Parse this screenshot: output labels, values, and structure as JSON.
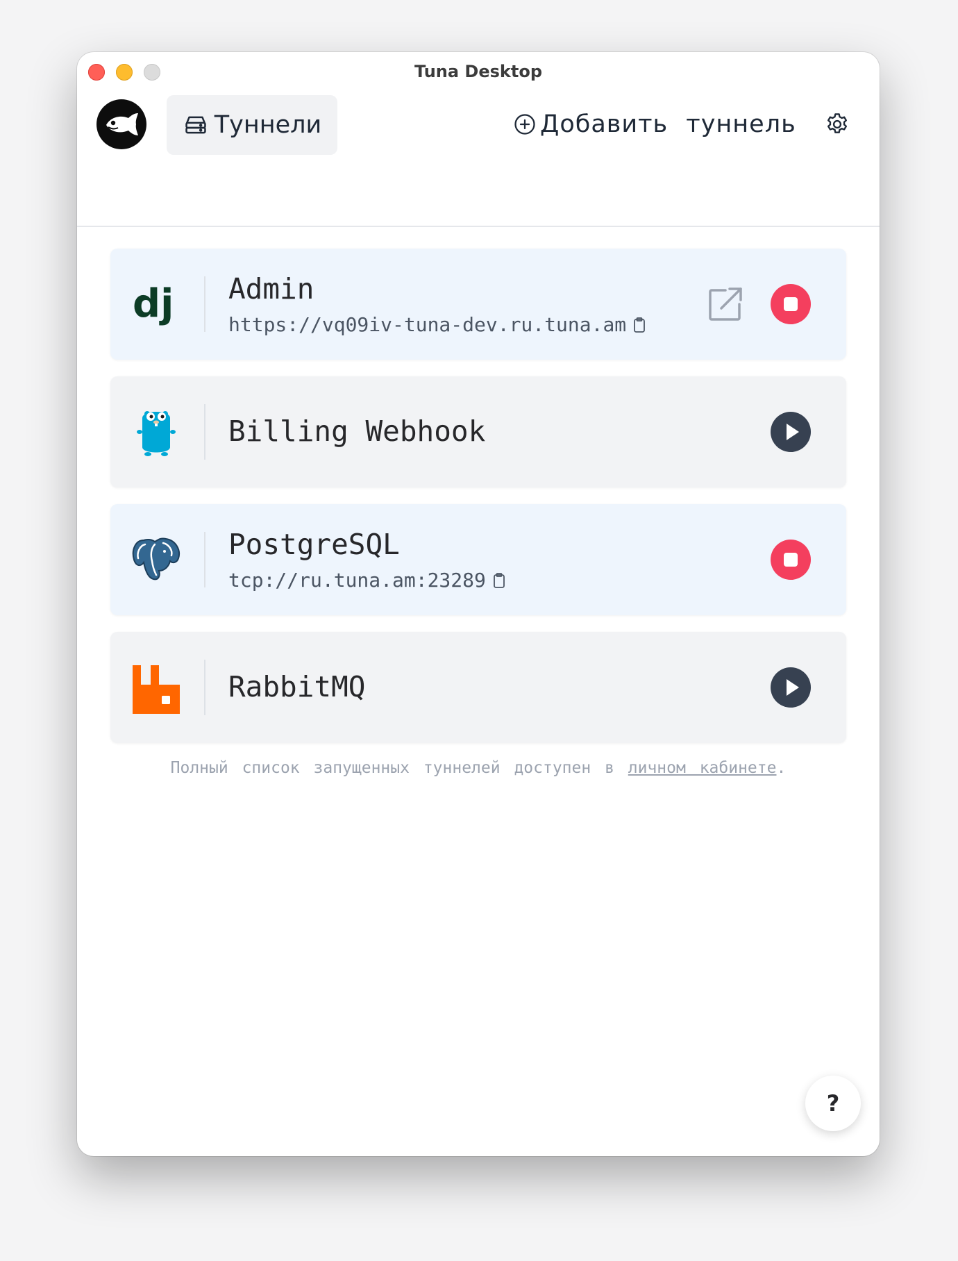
{
  "window": {
    "title": "Tuna Desktop"
  },
  "toolbar": {
    "tunnels_tab": "Туннели",
    "add_tunnel": "Добавить туннель"
  },
  "colors": {
    "running_bg": "#eef5fd",
    "stopped_bg": "#f2f3f5",
    "stop_button": "#f43f5e",
    "play_button": "#374151"
  },
  "tunnels": [
    {
      "name": "Admin",
      "url": "https://vq09iv-tuna-dev.ru.tuna.am",
      "status": "running",
      "icon": "django-icon",
      "has_open_link": true
    },
    {
      "name": "Billing Webhook",
      "url": "",
      "status": "stopped",
      "icon": "go-gopher-icon",
      "has_open_link": false
    },
    {
      "name": "PostgreSQL",
      "url": "tcp://ru.tuna.am:23289",
      "status": "running",
      "icon": "postgresql-icon",
      "has_open_link": false
    },
    {
      "name": "RabbitMQ",
      "url": "",
      "status": "stopped",
      "icon": "rabbitmq-icon",
      "has_open_link": false
    }
  ],
  "footer": {
    "note_prefix": "Полный список запущенных туннелей доступен в ",
    "note_link": "личном кабинете",
    "note_suffix": "."
  },
  "help_button": "?"
}
